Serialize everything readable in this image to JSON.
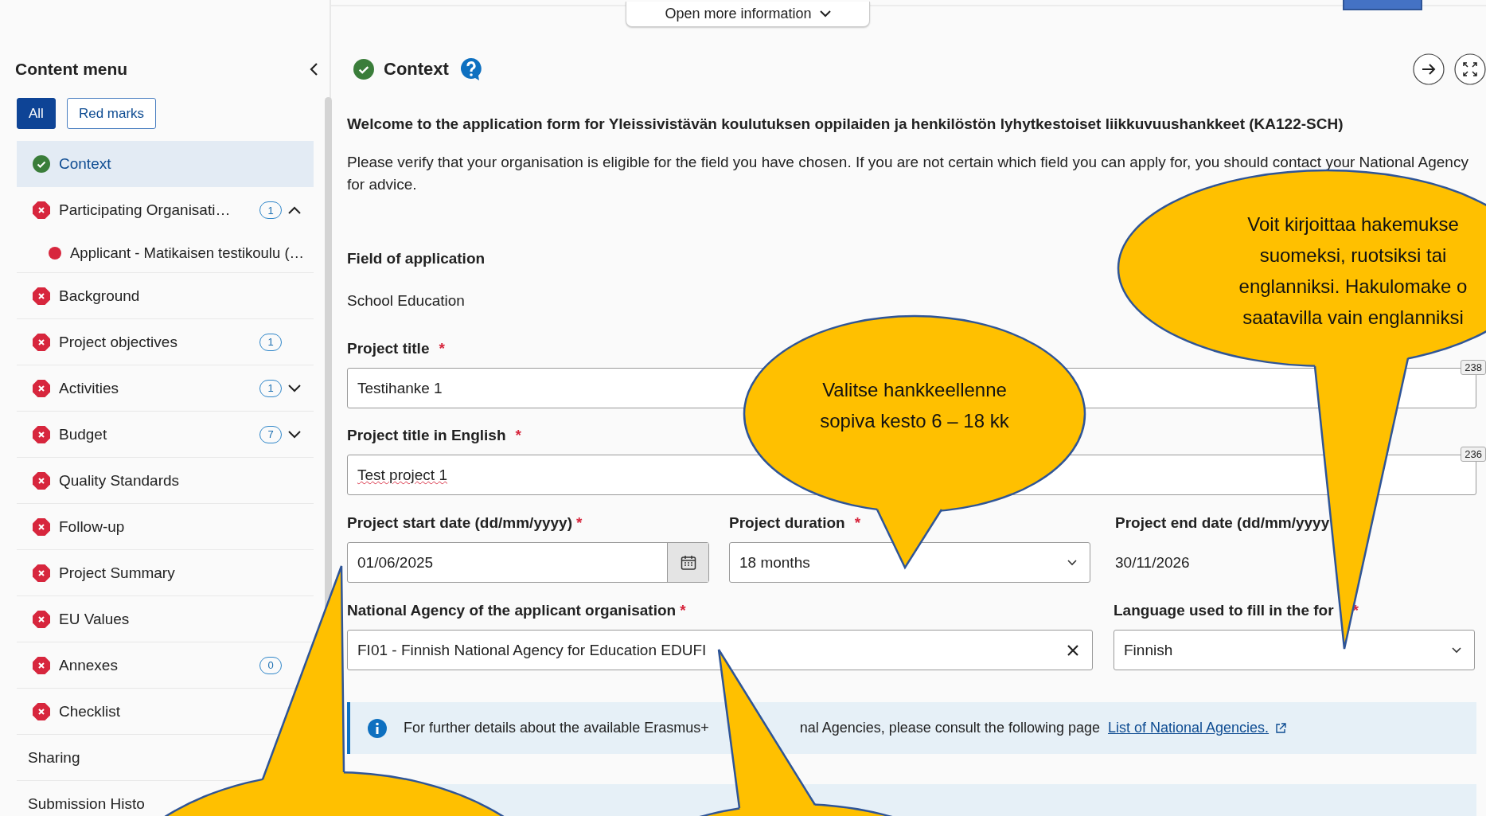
{
  "top_bar": {
    "more_button": "Open more information"
  },
  "sidebar": {
    "title": "Content menu",
    "filters": [
      {
        "label": "All",
        "selected": true
      },
      {
        "label": "Red marks",
        "selected": false
      }
    ],
    "items": [
      {
        "label": "Context",
        "kind": "complete",
        "selected": true
      },
      {
        "label": "Participating Organisati…",
        "kind": "error",
        "badge": "1",
        "expanded": true,
        "selected": false,
        "children": [
          {
            "label": "Applicant - Matikaisen testikoulu (…",
            "kind": "dot",
            "selected": false
          }
        ]
      },
      {
        "label": "Background",
        "kind": "error",
        "selected": false
      },
      {
        "label": "Project objectives",
        "kind": "error",
        "badge": "1",
        "selected": false
      },
      {
        "label": "Activities",
        "kind": "error",
        "badge": "1",
        "expanded": false,
        "selected": false
      },
      {
        "label": "Budget",
        "kind": "error",
        "badge": "7",
        "expanded": false,
        "selected": false
      },
      {
        "label": "Quality Standards",
        "kind": "error",
        "selected": false
      },
      {
        "label": "Follow-up",
        "kind": "error",
        "selected": false
      },
      {
        "label": "Project Summary",
        "kind": "error",
        "selected": false
      },
      {
        "label": "EU Values",
        "kind": "error",
        "selected": false
      },
      {
        "label": "Annexes",
        "kind": "error",
        "badge": "0",
        "selected": false
      },
      {
        "label": "Checklist",
        "kind": "error",
        "selected": false
      },
      {
        "label": "Sharing",
        "kind": "plain",
        "selected": false
      },
      {
        "label": "Submission Histo",
        "kind": "plain",
        "selected": false
      }
    ]
  },
  "section": {
    "title": "Context",
    "complete": true
  },
  "welcome": "Welcome to the application form for Yleissivistävän koulutuksen oppilaiden ja henkilöstön lyhytkestoiset liikkuvuushankkeet (KA122-SCH)",
  "intro": "Please verify that your organisation is eligible for the field you have chosen. If you are not certain which field you can apply for, you should contact your National Agency for advice.",
  "field_of_application": {
    "label": "Field of application",
    "value": "School Education"
  },
  "project_title": {
    "label": "Project title",
    "required_mark": "*",
    "value": "Testihanke 1",
    "counter": "238"
  },
  "project_title_en": {
    "label": "Project title in English",
    "required_mark": "*",
    "value": "Test project 1",
    "counter": "236"
  },
  "start_date": {
    "label": "Project start date (dd/mm/yyyy)",
    "required_mark": "*",
    "value": "01/06/2025"
  },
  "duration": {
    "label": "Project duration",
    "required_mark": "*",
    "value": "18 months"
  },
  "end_date": {
    "label": "Project end date (dd/mm/yyyy",
    "value": "30/11/2026"
  },
  "national_agency": {
    "label": "National Agency of the applicant organisation",
    "required_mark": "*",
    "value": "FI01 - Finnish National Agency for Education EDUFI"
  },
  "language": {
    "label": "Language used to fill in the for",
    "required_mark": "*",
    "value": "Finnish"
  },
  "info": {
    "text_parts": [
      "For further details about the available Erasmus+",
      "nal Agencies, please consult the following page"
    ],
    "link": "List of National Agencies."
  },
  "callouts": [
    {
      "kind": "bubble",
      "lines": [
        "Valitse hankkeellenne",
        "sopiva kesto 6 – 18 kk"
      ]
    },
    {
      "kind": "bubble",
      "lines": [
        "Voit kirjoittaa hakemukse",
        "suomeksi, ruotsiksi tai",
        "englanniksi. Hakulomake o",
        "saatavilla vain englanniksi"
      ]
    },
    {
      "kind": "bubble"
    },
    {
      "kind": "bubble"
    }
  ]
}
